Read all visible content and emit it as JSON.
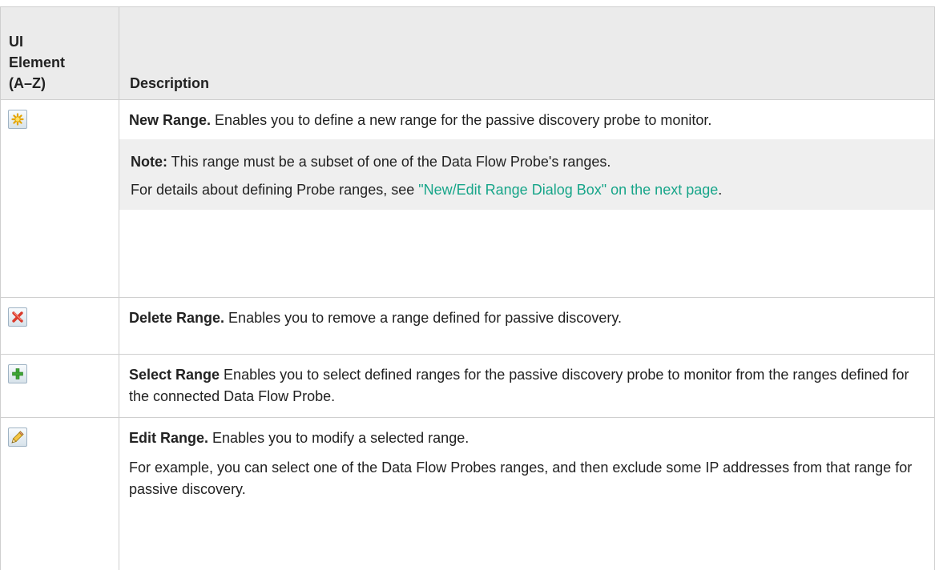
{
  "table": {
    "headers": {
      "ui_element": [
        "UI",
        "Element",
        "(A–Z)"
      ],
      "description": "Description"
    },
    "rows": [
      {
        "icon": "new-star-icon",
        "term": "New Range.",
        "text": " Enables you to define a new range for the passive discovery probe to monitor.",
        "note": {
          "label": "Note:",
          "text": " This range must be a subset of one of the Data Flow Probe's ranges.",
          "details_prefix": "For details about defining Probe ranges, see ",
          "link_text": "\"New/Edit Range Dialog Box\" on the next page",
          "details_suffix": "."
        }
      },
      {
        "icon": "delete-x-icon",
        "term": "Delete Range.",
        "text": " Enables you to remove a range defined for passive discovery."
      },
      {
        "icon": "add-plus-icon",
        "term": "Select Range",
        "text": " Enables you to select defined ranges for the passive discovery probe to monitor from the ranges defined for the connected Data Flow Probe."
      },
      {
        "icon": "edit-pencil-icon",
        "term": "Edit Range.",
        "text": " Enables you to modify a selected range.",
        "extra": "For example, you can select one of the Data Flow Probes ranges, and then exclude some IP addresses from that range for passive discovery."
      }
    ]
  },
  "colors": {
    "header_bg": "#ebebeb",
    "note_bg": "#efefef",
    "link": "#17a589",
    "border": "#cfcfcf"
  }
}
